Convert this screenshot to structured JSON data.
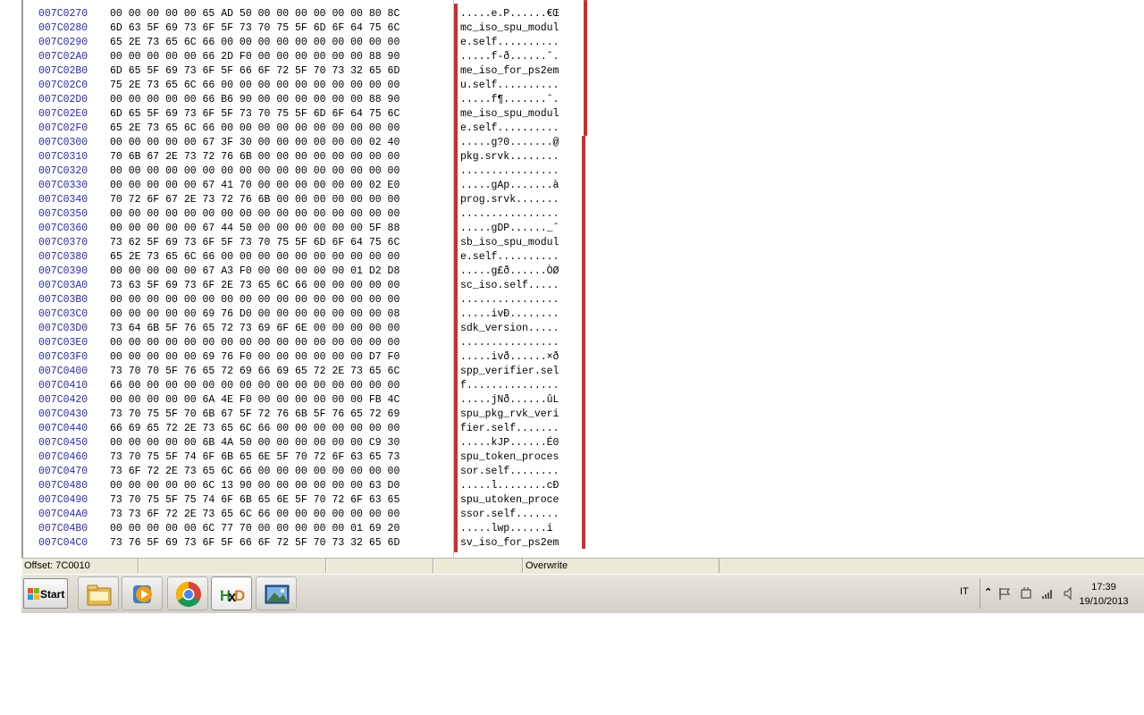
{
  "editor": {
    "rows": [
      {
        "offset": "007C0270",
        "hex": "00 00 00 00 00 65 AD 50 00 00 00 00 00 00 80 8C",
        "ascii": ".....e.P......€Œ"
      },
      {
        "offset": "007C0280",
        "hex": "6D 63 5F 69 73 6F 5F 73 70 75 5F 6D 6F 64 75 6C",
        "ascii": "mc_iso_spu_modul"
      },
      {
        "offset": "007C0290",
        "hex": "65 2E 73 65 6C 66 00 00 00 00 00 00 00 00 00 00",
        "ascii": "e.self.........."
      },
      {
        "offset": "007C02A0",
        "hex": "00 00 00 00 00 66 2D F0 00 00 00 00 00 00 88 90",
        "ascii": ".....f-ð......ˆ."
      },
      {
        "offset": "007C02B0",
        "hex": "6D 65 5F 69 73 6F 5F 66 6F 72 5F 70 73 32 65 6D",
        "ascii": "me_iso_for_ps2em"
      },
      {
        "offset": "007C02C0",
        "hex": "75 2E 73 65 6C 66 00 00 00 00 00 00 00 00 00 00",
        "ascii": "u.self.........."
      },
      {
        "offset": "007C02D0",
        "hex": "00 00 00 00 00 66 B6 90 00 00 00 00 00 00 88 90",
        "ascii": ".....f¶.......ˆ."
      },
      {
        "offset": "007C02E0",
        "hex": "6D 65 5F 69 73 6F 5F 73 70 75 5F 6D 6F 64 75 6C",
        "ascii": "me_iso_spu_modul"
      },
      {
        "offset": "007C02F0",
        "hex": "65 2E 73 65 6C 66 00 00 00 00 00 00 00 00 00 00",
        "ascii": "e.self.........."
      },
      {
        "offset": "007C0300",
        "hex": "00 00 00 00 00 67 3F 30 00 00 00 00 00 00 02 40",
        "ascii": ".....g?0.......@"
      },
      {
        "offset": "007C0310",
        "hex": "70 6B 67 2E 73 72 76 6B 00 00 00 00 00 00 00 00",
        "ascii": "pkg.srvk........"
      },
      {
        "offset": "007C0320",
        "hex": "00 00 00 00 00 00 00 00 00 00 00 00 00 00 00 00",
        "ascii": "................"
      },
      {
        "offset": "007C0330",
        "hex": "00 00 00 00 00 67 41 70 00 00 00 00 00 00 02 E0",
        "ascii": ".....gAp.......à"
      },
      {
        "offset": "007C0340",
        "hex": "70 72 6F 67 2E 73 72 76 6B 00 00 00 00 00 00 00",
        "ascii": "prog.srvk......."
      },
      {
        "offset": "007C0350",
        "hex": "00 00 00 00 00 00 00 00 00 00 00 00 00 00 00 00",
        "ascii": "................"
      },
      {
        "offset": "007C0360",
        "hex": "00 00 00 00 00 67 44 50 00 00 00 00 00 00 5F 88",
        "ascii": ".....gDP......_ˆ"
      },
      {
        "offset": "007C0370",
        "hex": "73 62 5F 69 73 6F 5F 73 70 75 5F 6D 6F 64 75 6C",
        "ascii": "sb_iso_spu_modul"
      },
      {
        "offset": "007C0380",
        "hex": "65 2E 73 65 6C 66 00 00 00 00 00 00 00 00 00 00",
        "ascii": "e.self.........."
      },
      {
        "offset": "007C0390",
        "hex": "00 00 00 00 00 67 A3 F0 00 00 00 00 00 01 D2 D8",
        "ascii": ".....g£ð......ÒØ"
      },
      {
        "offset": "007C03A0",
        "hex": "73 63 5F 69 73 6F 2E 73 65 6C 66 00 00 00 00 00",
        "ascii": "sc_iso.self....."
      },
      {
        "offset": "007C03B0",
        "hex": "00 00 00 00 00 00 00 00 00 00 00 00 00 00 00 00",
        "ascii": "................"
      },
      {
        "offset": "007C03C0",
        "hex": "00 00 00 00 00 69 76 D0 00 00 00 00 00 00 00 08",
        "ascii": ".....ivÐ........"
      },
      {
        "offset": "007C03D0",
        "hex": "73 64 6B 5F 76 65 72 73 69 6F 6E 00 00 00 00 00",
        "ascii": "sdk_version....."
      },
      {
        "offset": "007C03E0",
        "hex": "00 00 00 00 00 00 00 00 00 00 00 00 00 00 00 00",
        "ascii": "................"
      },
      {
        "offset": "007C03F0",
        "hex": "00 00 00 00 00 69 76 F0 00 00 00 00 00 00 D7 F0",
        "ascii": ".....ivð......×ð"
      },
      {
        "offset": "007C0400",
        "hex": "73 70 70 5F 76 65 72 69 66 69 65 72 2E 73 65 6C",
        "ascii": "spp_verifier.sel"
      },
      {
        "offset": "007C0410",
        "hex": "66 00 00 00 00 00 00 00 00 00 00 00 00 00 00 00",
        "ascii": "f..............."
      },
      {
        "offset": "007C0420",
        "hex": "00 00 00 00 00 6A 4E F0 00 00 00 00 00 00 FB 4C",
        "ascii": ".....jNð......ûL"
      },
      {
        "offset": "007C0430",
        "hex": "73 70 75 5F 70 6B 67 5F 72 76 6B 5F 76 65 72 69",
        "ascii": "spu_pkg_rvk_veri"
      },
      {
        "offset": "007C0440",
        "hex": "66 69 65 72 2E 73 65 6C 66 00 00 00 00 00 00 00",
        "ascii": "fier.self......."
      },
      {
        "offset": "007C0450",
        "hex": "00 00 00 00 00 6B 4A 50 00 00 00 00 00 00 C9 30",
        "ascii": ".....kJP......É0"
      },
      {
        "offset": "007C0460",
        "hex": "73 70 75 5F 74 6F 6B 65 6E 5F 70 72 6F 63 65 73",
        "ascii": "spu_token_proces"
      },
      {
        "offset": "007C0470",
        "hex": "73 6F 72 2E 73 65 6C 66 00 00 00 00 00 00 00 00",
        "ascii": "sor.self........"
      },
      {
        "offset": "007C0480",
        "hex": "00 00 00 00 00 6C 13 90 00 00 00 00 00 00 63 D0",
        "ascii": ".....l........cÐ"
      },
      {
        "offset": "007C0490",
        "hex": "73 70 75 5F 75 74 6F 6B 65 6E 5F 70 72 6F 63 65",
        "ascii": "spu_utoken_proce"
      },
      {
        "offset": "007C04A0",
        "hex": "73 73 6F 72 2E 73 65 6C 66 00 00 00 00 00 00 00",
        "ascii": "ssor.self......."
      },
      {
        "offset": "007C04B0",
        "hex": "00 00 00 00 00 6C 77 70 00 00 00 00 00 01 69 20",
        "ascii": ".....lwp......i "
      },
      {
        "offset": "007C04C0",
        "hex": "73 76 5F 69 73 6F 5F 66 6F 72 5F 70 73 32 65 6D",
        "ascii": "sv_iso_for_ps2em"
      }
    ]
  },
  "statusbar": {
    "offset": "Offset: 7C0010",
    "cell2": "",
    "cell3": "",
    "cell4": "",
    "mode": "Overwrite"
  },
  "taskbar": {
    "start_label": "Start",
    "apps": [
      {
        "name": "explorer",
        "icon": "folder-icon"
      },
      {
        "name": "media-player",
        "icon": "media-player-icon"
      },
      {
        "name": "chrome",
        "icon": "chrome-icon"
      },
      {
        "name": "hxd",
        "icon": "hxd-icon",
        "label": "HxD"
      },
      {
        "name": "photo-viewer",
        "icon": "photo-viewer-icon"
      }
    ]
  },
  "tray": {
    "language": "IT",
    "time": "17:39",
    "date": "19/10/2013"
  },
  "colors": {
    "offset_text": "#2a2ab8",
    "highlight_line": "#d42a2a",
    "statusbar_bg": "#ece9d8"
  }
}
